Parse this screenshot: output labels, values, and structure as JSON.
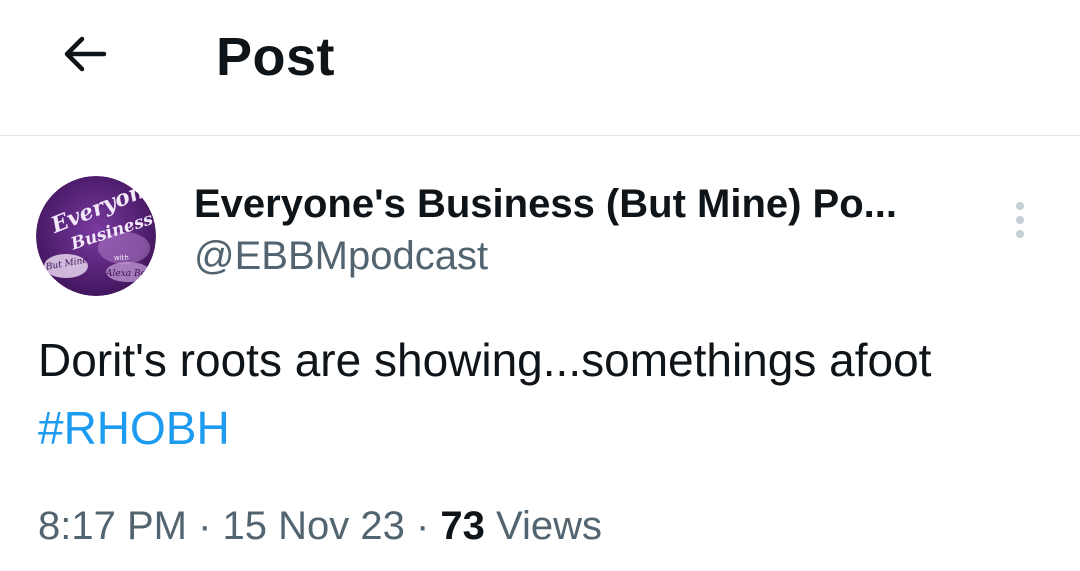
{
  "header": {
    "title": "Post"
  },
  "author": {
    "display_name": "Everyone's Business (But Mine) Po...",
    "handle": "@EBBMpodcast",
    "avatar_text": "Everyone's Business But Mine with Alexa Bea"
  },
  "post": {
    "text": "Dorit's roots are showing...somethings afoot ",
    "hashtag": "#RHOBH"
  },
  "meta": {
    "time": "8:17 PM",
    "sep1": " · ",
    "date": "15 Nov 23",
    "sep2": " · ",
    "views_count": "73",
    "views_label": " Views"
  },
  "colors": {
    "text": "#0f1419",
    "secondary": "#536471",
    "link": "#1d9bf0",
    "avatar_bg": "#4a1b6b"
  },
  "icons": {
    "back": "arrow-left-icon",
    "more": "more-vertical-icon"
  }
}
